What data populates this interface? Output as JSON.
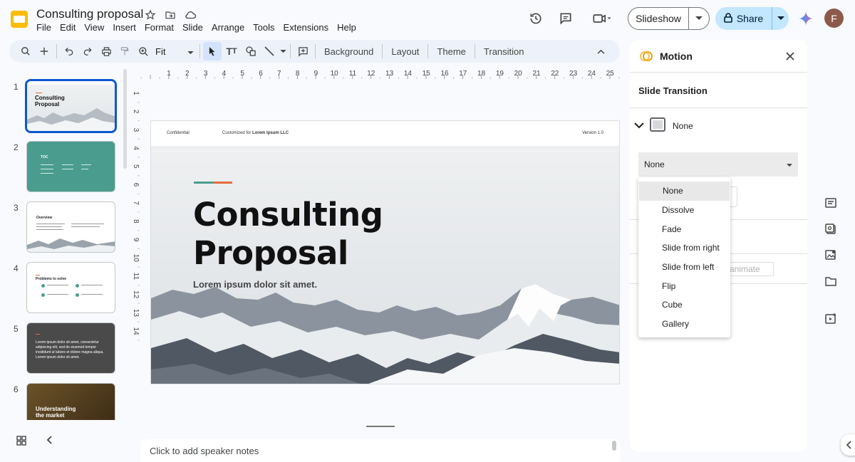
{
  "document": {
    "title": "Consulting proposal"
  },
  "colors": {
    "accent_blue": "#0b57d0",
    "share_bg": "#c2e7ff",
    "teal": "#4a9d8e",
    "orange": "#e06c3c"
  },
  "menu": [
    "File",
    "Edit",
    "View",
    "Insert",
    "Format",
    "Slide",
    "Arrange",
    "Tools",
    "Extensions",
    "Help"
  ],
  "header_actions": {
    "slideshow_label": "Slideshow",
    "share_label": "Share",
    "avatar_initial": "F"
  },
  "toolbar": {
    "zoom_value": "Fit",
    "background_label": "Background",
    "layout_label": "Layout",
    "theme_label": "Theme",
    "transition_label": "Transition"
  },
  "ruler": {
    "h_ticks": [
      "1",
      "2",
      "3",
      "4",
      "5",
      "6",
      "7",
      "8",
      "9",
      "10",
      "11",
      "12",
      "13",
      "14",
      "15",
      "16",
      "17",
      "18",
      "19",
      "20",
      "21",
      "22",
      "23",
      "24",
      "25"
    ],
    "v_ticks": [
      "1",
      "2",
      "3",
      "4",
      "5",
      "6",
      "7",
      "8",
      "9",
      "10",
      "11",
      "12",
      "13",
      "14"
    ]
  },
  "slides": [
    {
      "num": "1",
      "title": "Consulting Proposal"
    },
    {
      "num": "2",
      "title": "TOC"
    },
    {
      "num": "3",
      "title": "Overview"
    },
    {
      "num": "4",
      "title": "Problems to solve"
    },
    {
      "num": "5",
      "title": "Lorem ipsum dolor sit amet, consectetur adipiscing elit, sed do eiusmod tempor incididunt ut labore et dolore magna aliqua. Lorem ipsum dolor sit amet."
    },
    {
      "num": "6",
      "title": "Understanding the market"
    }
  ],
  "current_slide": {
    "header_left": "Confidential",
    "header_mid_prefix": "Customized for",
    "header_mid_client": "Lorem Ipsum LLC",
    "header_right": "Version 1.0",
    "title_line1": "Consulting",
    "title_line2": "Proposal",
    "subtitle": "Lorem ipsum dolor sit amet."
  },
  "notes": {
    "placeholder": "Click to add speaker notes"
  },
  "panel": {
    "title": "Motion",
    "section": "Slide Transition",
    "current_transition": "None",
    "select_value": "None",
    "animate_label": "animate"
  },
  "dropdown": {
    "options": [
      "None",
      "Dissolve",
      "Fade",
      "Slide from right",
      "Slide from left",
      "Flip",
      "Cube",
      "Gallery"
    ],
    "selected": "None"
  }
}
